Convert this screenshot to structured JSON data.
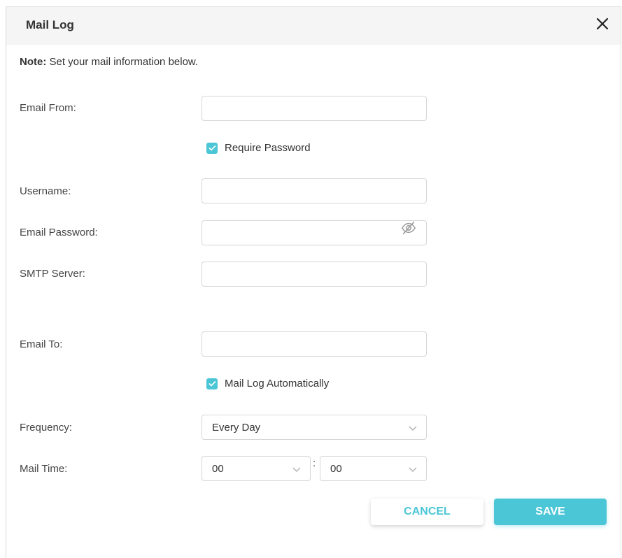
{
  "dialog": {
    "title": "Mail Log"
  },
  "note": {
    "prefix": "Note:",
    "text": "Set your mail information below."
  },
  "fields": {
    "email_from": {
      "label": "Email From:",
      "value": ""
    },
    "require_password": {
      "label": "Require Password",
      "checked": true
    },
    "username": {
      "label": "Username:",
      "value": ""
    },
    "email_password": {
      "label": "Email Password:",
      "value": ""
    },
    "smtp_server": {
      "label": "SMTP Server:",
      "value": ""
    },
    "email_to": {
      "label": "Email To:",
      "value": ""
    },
    "mail_log_auto": {
      "label": "Mail Log Automatically",
      "checked": true
    },
    "frequency": {
      "label": "Frequency:",
      "value": "Every Day"
    },
    "mail_time": {
      "label": "Mail Time:",
      "hour": "00",
      "separator": ":",
      "minute": "00"
    }
  },
  "buttons": {
    "cancel": "CANCEL",
    "save": "SAVE"
  },
  "colors": {
    "accent": "#4bc6d6",
    "header_bg": "#f5f5f5"
  },
  "icons": [
    "close-icon",
    "eye-off-icon",
    "checkmark-icon",
    "chevron-down-icon"
  ]
}
